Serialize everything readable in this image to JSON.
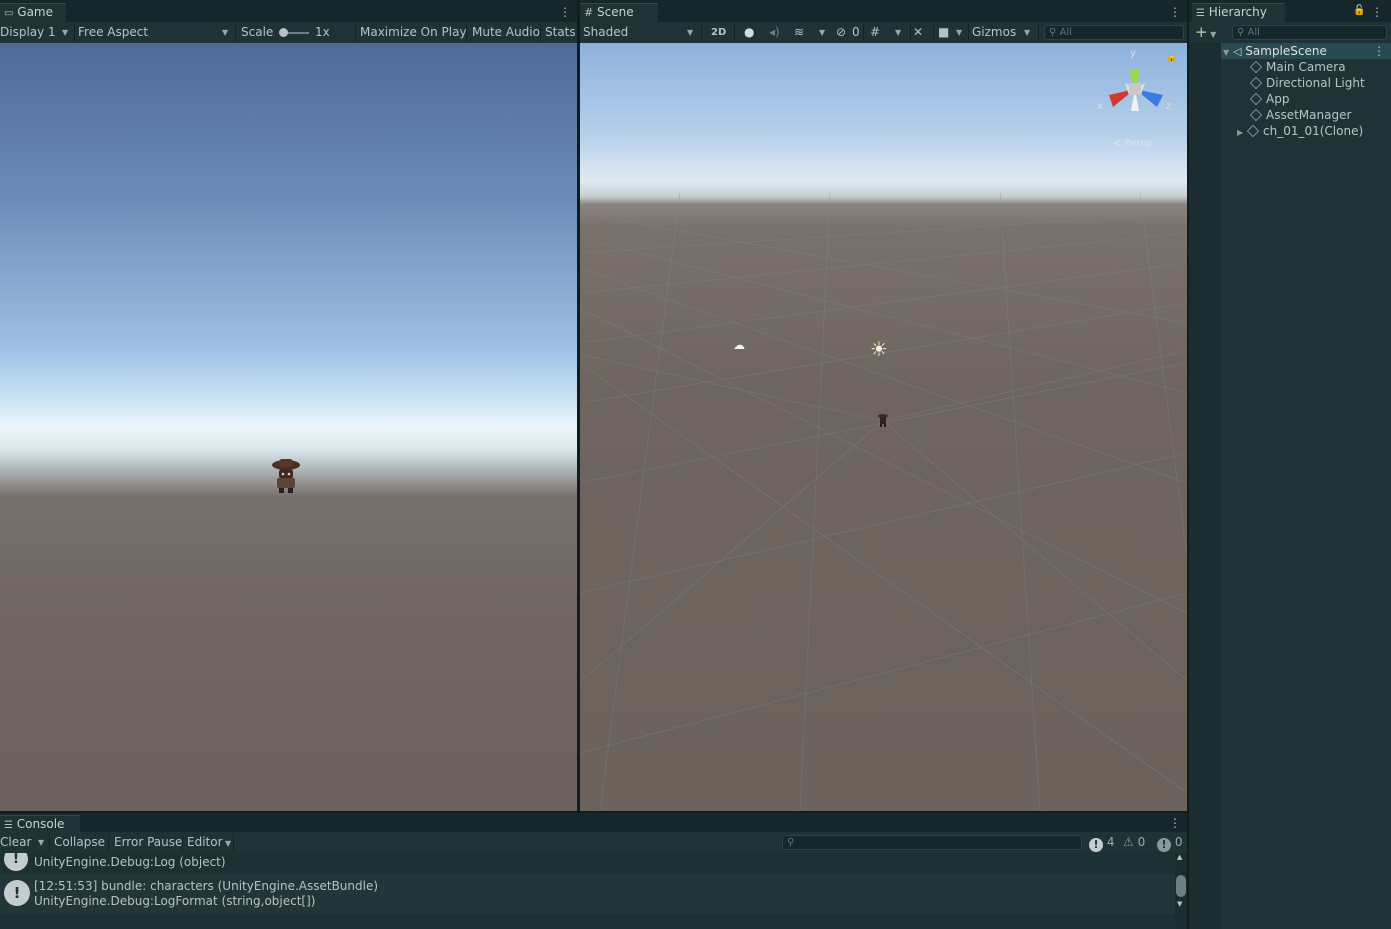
{
  "game": {
    "tab_label": "Game",
    "display_label": "Display 1",
    "aspect_label": "Free Aspect",
    "scale_label": "Scale",
    "scale_value": "1x",
    "maximize_label": "Maximize On Play",
    "mute_label": "Mute Audio",
    "stats_label": "Stats"
  },
  "scene": {
    "tab_label": "Scene",
    "shading_label": "Shaded",
    "mode_2d": "2D",
    "hidden_count": "0",
    "gizmos_label": "Gizmos",
    "search_placeholder": "All",
    "axis_y": "y",
    "axis_x": "x",
    "axis_z": "z",
    "persp_label": "Persp"
  },
  "hierarchy": {
    "tab_label": "Hierarchy",
    "search_placeholder": "All",
    "scene_name": "SampleScene",
    "items": [
      {
        "label": "Main Camera"
      },
      {
        "label": "Directional Light"
      },
      {
        "label": "App"
      },
      {
        "label": "AssetManager"
      },
      {
        "label": "ch_01_01(Clone)"
      }
    ]
  },
  "console": {
    "tab_label": "Console",
    "clear_label": "Clear",
    "collapse_label": "Collapse",
    "error_pause_label": "Error Pause",
    "editor_label": "Editor",
    "log_count": "4",
    "warning_count": "0",
    "error_count": "0",
    "entries": [
      {
        "line1": "UnityEngine.Debug:Log (object)"
      },
      {
        "line1": "[12:51:53] bundle: characters (UnityEngine.AssetBundle)",
        "line2": "UnityEngine.Debug:LogFormat (string,object[])"
      }
    ]
  }
}
